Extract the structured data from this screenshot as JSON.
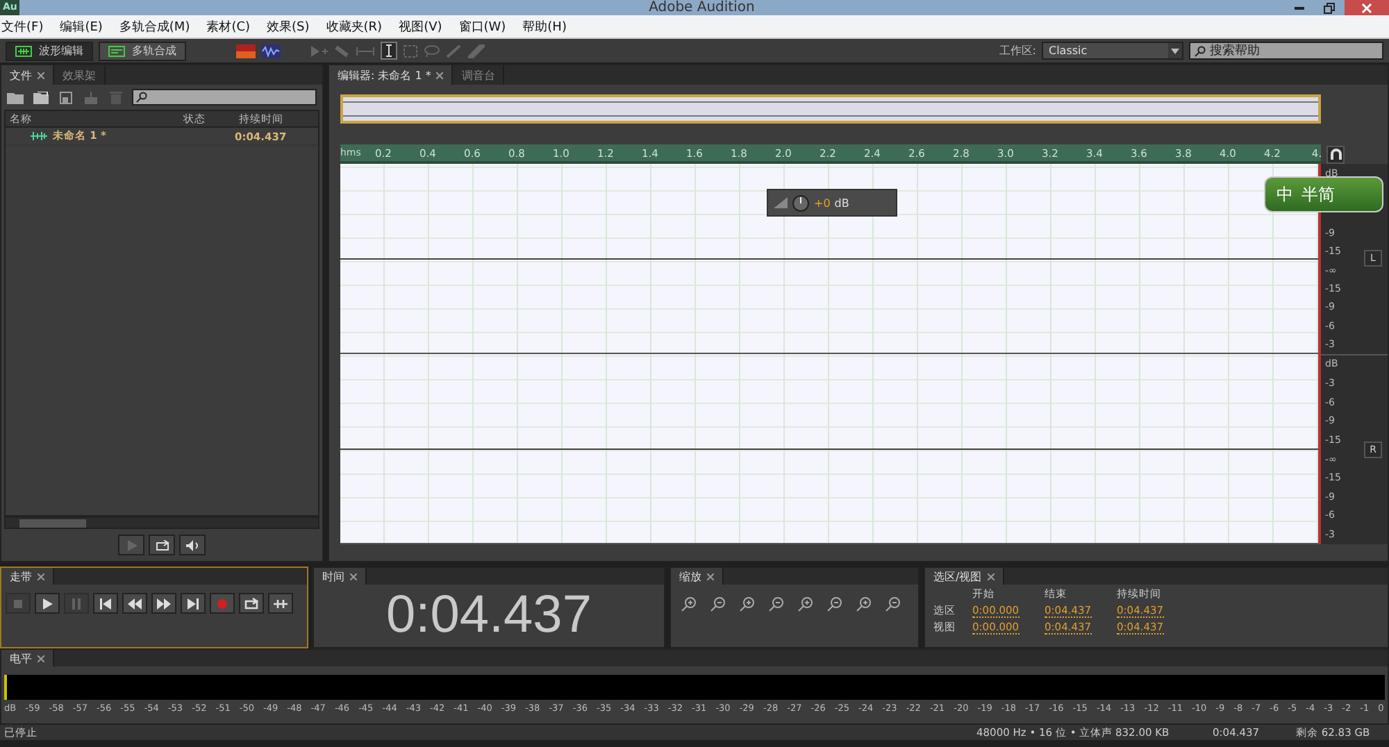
{
  "window": {
    "title": "Adobe Audition",
    "app_badge": "Au"
  },
  "menu": [
    "文件(F)",
    "编辑(E)",
    "多轨合成(M)",
    "素材(C)",
    "效果(S)",
    "收藏夹(R)",
    "视图(V)",
    "窗口(W)",
    "帮助(H)"
  ],
  "toolbar": {
    "modes": [
      {
        "label": "波形编辑",
        "selected": true
      },
      {
        "label": "多轨合成",
        "selected": false
      }
    ],
    "workspace_label": "工作区:",
    "workspace": "Classic",
    "help_search": {
      "placeholder": "搜索帮助"
    }
  },
  "files_panel": {
    "tabs": [
      {
        "label": "文件",
        "selected": true
      },
      {
        "label": "效果架",
        "selected": false
      }
    ],
    "columns": [
      "名称",
      "状态",
      "持续时间"
    ],
    "rows": [
      {
        "name": "未命名 1 *",
        "duration": "0:04.437"
      }
    ]
  },
  "editor": {
    "tabs": [
      {
        "label": "编辑器: 未命名 1 *",
        "selected": true
      },
      {
        "label": "调音台",
        "selected": false
      }
    ],
    "ruler_unit": "hms",
    "ruler": [
      "0.2",
      "0.4",
      "0.6",
      "0.8",
      "1.0",
      "1.2",
      "1.4",
      "1.6",
      "1.8",
      "2.0",
      "2.2",
      "2.4",
      "2.6",
      "2.8",
      "3.0",
      "3.2",
      "3.4",
      "3.6",
      "3.8",
      "4.0",
      "4.2",
      "4."
    ],
    "hud": {
      "value": "+0",
      "unit": "dB"
    },
    "channels": [
      {
        "label": "L",
        "scale": [
          "dB",
          "-9",
          "-15",
          "-∞",
          "-15",
          "-9",
          "-6",
          "-3"
        ]
      },
      {
        "label": "R",
        "scale": [
          "dB",
          "-3",
          "-6",
          "-9",
          "-15",
          "-∞",
          "-15",
          "-9",
          "-6",
          "-3"
        ]
      }
    ]
  },
  "transport": {
    "title": "走带",
    "buttons": [
      {
        "kind": "stop",
        "disabled": true
      },
      {
        "kind": "play",
        "disabled": false
      },
      {
        "kind": "pause",
        "disabled": true
      },
      {
        "kind": "start",
        "disabled": false
      },
      {
        "kind": "rewind",
        "disabled": false
      },
      {
        "kind": "forward",
        "disabled": false
      },
      {
        "kind": "end",
        "disabled": false
      },
      {
        "kind": "record",
        "disabled": false
      },
      {
        "kind": "loop",
        "disabled": false
      },
      {
        "kind": "skip",
        "disabled": false
      }
    ]
  },
  "time": {
    "title": "时间",
    "value": "0:04.437"
  },
  "zoom": {
    "title": "缩放"
  },
  "selection": {
    "title": "选区/视图",
    "columns": [
      "开始",
      "结束",
      "持续时间"
    ],
    "rows": [
      {
        "label": "选区",
        "values": [
          "0:00.000",
          "0:04.437",
          "0:04.437"
        ]
      },
      {
        "label": "视图",
        "values": [
          "0:00.000",
          "0:04.437",
          "0:04.437"
        ]
      }
    ]
  },
  "levels": {
    "title": "电平",
    "scale": [
      "dB",
      "-59",
      "-58",
      "-57",
      "-56",
      "-55",
      "-54",
      "-53",
      "-52",
      "-51",
      "-50",
      "-49",
      "-48",
      "-47",
      "-46",
      "-45",
      "-44",
      "-43",
      "-42",
      "-41",
      "-40",
      "-39",
      "-38",
      "-37",
      "-36",
      "-35",
      "-34",
      "-33",
      "-32",
      "-31",
      "-30",
      "-29",
      "-28",
      "-27",
      "-26",
      "-25",
      "-24",
      "-23",
      "-22",
      "-21",
      "-20",
      "-19",
      "-18",
      "-17",
      "-16",
      "-15",
      "-14",
      "-13",
      "-12",
      "-11",
      "-10",
      "-9",
      "-8",
      "-7",
      "-6",
      "-5",
      "-4",
      "-3",
      "-2",
      "-1",
      "0"
    ]
  },
  "status_bar": {
    "state": "已停止",
    "items": [
      "48000 Hz • 16 位 • 立体声",
      "832.00 KB",
      "0:04.437",
      "剩余 62.83 GB"
    ]
  },
  "ime": {
    "language": "中",
    "mode": "半简"
  }
}
